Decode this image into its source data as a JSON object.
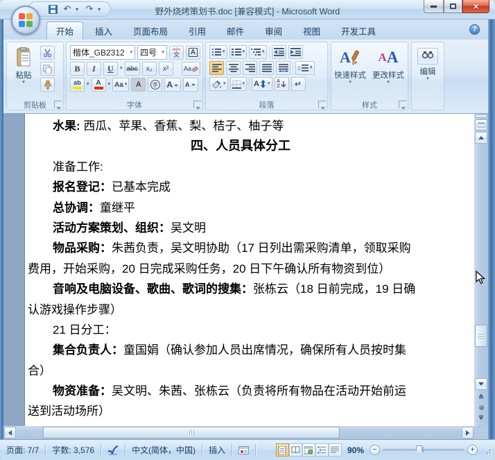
{
  "titlebar": {
    "title": "野外烧烤策划书.doc [兼容模式] - Microsoft Word"
  },
  "tabs": [
    {
      "label": "开始"
    },
    {
      "label": "插入"
    },
    {
      "label": "页面布局"
    },
    {
      "label": "引用"
    },
    {
      "label": "邮件"
    },
    {
      "label": "审阅"
    },
    {
      "label": "视图"
    },
    {
      "label": "开发工具"
    }
  ],
  "ribbon": {
    "clipboard": {
      "group_label": "剪贴板",
      "paste_label": "粘贴"
    },
    "font": {
      "group_label": "字体",
      "font_name": "楷体_GB2312",
      "font_size": "四号",
      "bold": "B",
      "italic": "I",
      "underline": "U",
      "strikethrough": "abc",
      "subscript": "x₂",
      "superscript": "x²",
      "clear_format": "Aa",
      "highlight": "ab",
      "font_color": "A",
      "change_case": "Aa",
      "char_shading": "A",
      "enclose_char": "字",
      "grow_font": "A",
      "shrink_font": "A",
      "phonetic_top": "wén",
      "phonetic_bottom": "文",
      "char_border": "A",
      "asian_layout": "A"
    },
    "paragraph": {
      "group_label": "段落",
      "sort_a": "A",
      "sort_z": "Z",
      "show_hide": "↵",
      "line_spacing_arrow": "↕"
    },
    "styles": {
      "group_label": "样式",
      "quick_styles": "快速样式",
      "change_styles": "更改样式",
      "quick_icon": "A",
      "change_icon_1": "A",
      "change_icon_2": "A"
    },
    "editing": {
      "button_label": "编辑"
    }
  },
  "document": {
    "lines": [
      {
        "b": "水果:",
        "t": " 西瓜、苹果、香蕉、梨、桔子、柚子等"
      },
      {
        "b": "四、人员具体分工",
        "t": ""
      },
      {
        "b": "",
        "t": "准备工作:"
      },
      {
        "b": "报名登记：",
        "t": "已基本完成"
      },
      {
        "b": "总协调：",
        "t": "童继平"
      },
      {
        "b": "活动方案策划、组织：",
        "t": "吴文明"
      },
      {
        "b": "物品采购：",
        "t": "朱茜负责，吴文明协助（17 日列出需采购清单，领取采购"
      },
      {
        "b": "",
        "t": "费用，开始采购，20 日完成采购任务，20 日下午确认所有物资到位）"
      },
      {
        "b": "音响及电脑设备、歌曲、歌词的搜集：",
        "t": "张栋云（18 日前完成，19 日确"
      },
      {
        "b": "",
        "t": "认游戏操作步骤）"
      },
      {
        "b": "",
        "t": "21 日分工："
      },
      {
        "b": "集合负责人：",
        "t": "童国娟（确认参加人员出席情况，确保所有人员按时集"
      },
      {
        "b": "",
        "t": "合）"
      },
      {
        "b": "物资准备：",
        "t": "吴文明、朱茜、张栋云（负责将所有物品在活动开始前运"
      },
      {
        "b": "",
        "t": "送到活动场所）"
      }
    ]
  },
  "statusbar": {
    "page": "页面: 7/7",
    "words": "字数: 3,576",
    "language": "中文(简体，中国)",
    "insert_mode": "插入",
    "zoom_level": "90%"
  },
  "icons": {
    "undo": "↶",
    "redo": "↷",
    "dropdown": "▾",
    "help": "?",
    "close": "×"
  }
}
